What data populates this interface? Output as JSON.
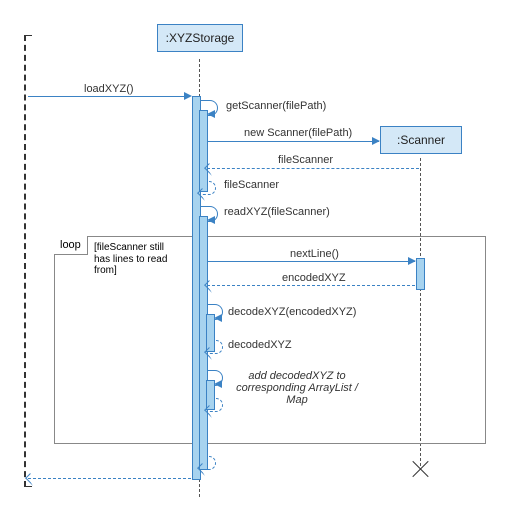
{
  "actors": {
    "storage": ":XYZStorage",
    "scanner": ":Scanner"
  },
  "loop": {
    "tag": "loop",
    "guard": "[fileScanner still has lines to read from]"
  },
  "messages": {
    "loadXYZ": "loadXYZ()",
    "getScanner": "getScanner(filePath)",
    "newScanner": "new Scanner(filePath)",
    "fileScanner1": "fileScanner",
    "fileScanner2": "fileScanner",
    "readXYZ": "readXYZ(fileScanner)",
    "nextLine": "nextLine()",
    "encodedXYZ": "encodedXYZ",
    "decodeXYZ": "decodeXYZ(encodedXYZ)",
    "decodedXYZ": "decodedXYZ",
    "addDecoded": "add decodedXYZ to corresponding ArrayList / Map"
  }
}
